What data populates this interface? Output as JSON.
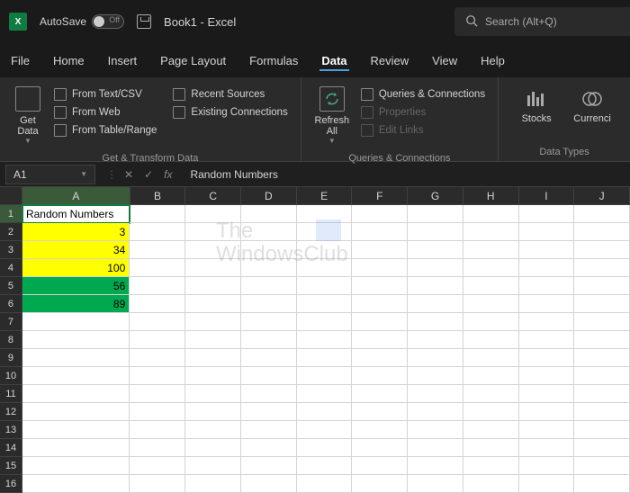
{
  "titlebar": {
    "autosave_label": "AutoSave",
    "autosave_state": "Off",
    "title": "Book1 - Excel",
    "search_placeholder": "Search (Alt+Q)"
  },
  "tabs": [
    "File",
    "Home",
    "Insert",
    "Page Layout",
    "Formulas",
    "Data",
    "Review",
    "View",
    "Help"
  ],
  "active_tab": "Data",
  "ribbon": {
    "group1": {
      "label": "Get & Transform Data",
      "big": "Get Data",
      "items": [
        "From Text/CSV",
        "From Web",
        "From Table/Range",
        "Recent Sources",
        "Existing Connections"
      ]
    },
    "group2": {
      "label": "Queries & Connections",
      "big": "Refresh All",
      "items": [
        "Queries & Connections",
        "Properties",
        "Edit Links"
      ]
    },
    "group3": {
      "label": "Data Types",
      "items": [
        "Stocks",
        "Currenci"
      ]
    }
  },
  "namebox": "A1",
  "formula": "Random Numbers",
  "columns": [
    "A",
    "B",
    "C",
    "D",
    "E",
    "F",
    "G",
    "H",
    "I",
    "J"
  ],
  "rows": [
    1,
    2,
    3,
    4,
    5,
    6,
    7,
    8,
    9,
    10,
    11,
    12,
    13,
    14,
    15,
    16
  ],
  "cells": {
    "A1": "Random Numbers",
    "A2": "3",
    "A3": "34",
    "A4": "100",
    "A5": "56",
    "A6": "89"
  },
  "watermark": {
    "line1": "The",
    "line2": "WindowsClub"
  }
}
